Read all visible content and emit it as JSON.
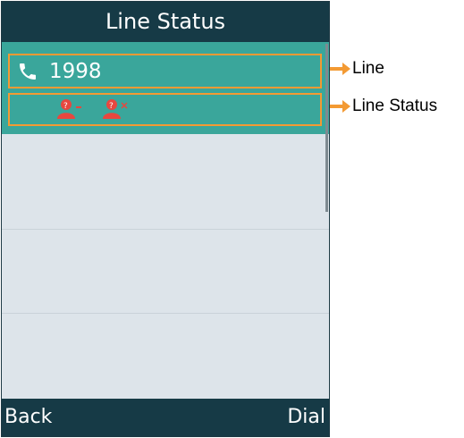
{
  "screen": {
    "title": "Line Status",
    "line": {
      "icon": "phone-handset-icon",
      "number": "1998"
    },
    "status_icons": [
      "user-status-icon-1",
      "user-status-icon-2"
    ],
    "softkeys": {
      "left": "Back",
      "right": "Dial"
    }
  },
  "annotations": {
    "line": "Line",
    "line_status": "Line Status"
  },
  "colors": {
    "header": "#163a46",
    "highlight": "#3aa69b",
    "annotation": "#f39a33",
    "status_icon": "#e8473f",
    "background": "#dde4ea"
  }
}
